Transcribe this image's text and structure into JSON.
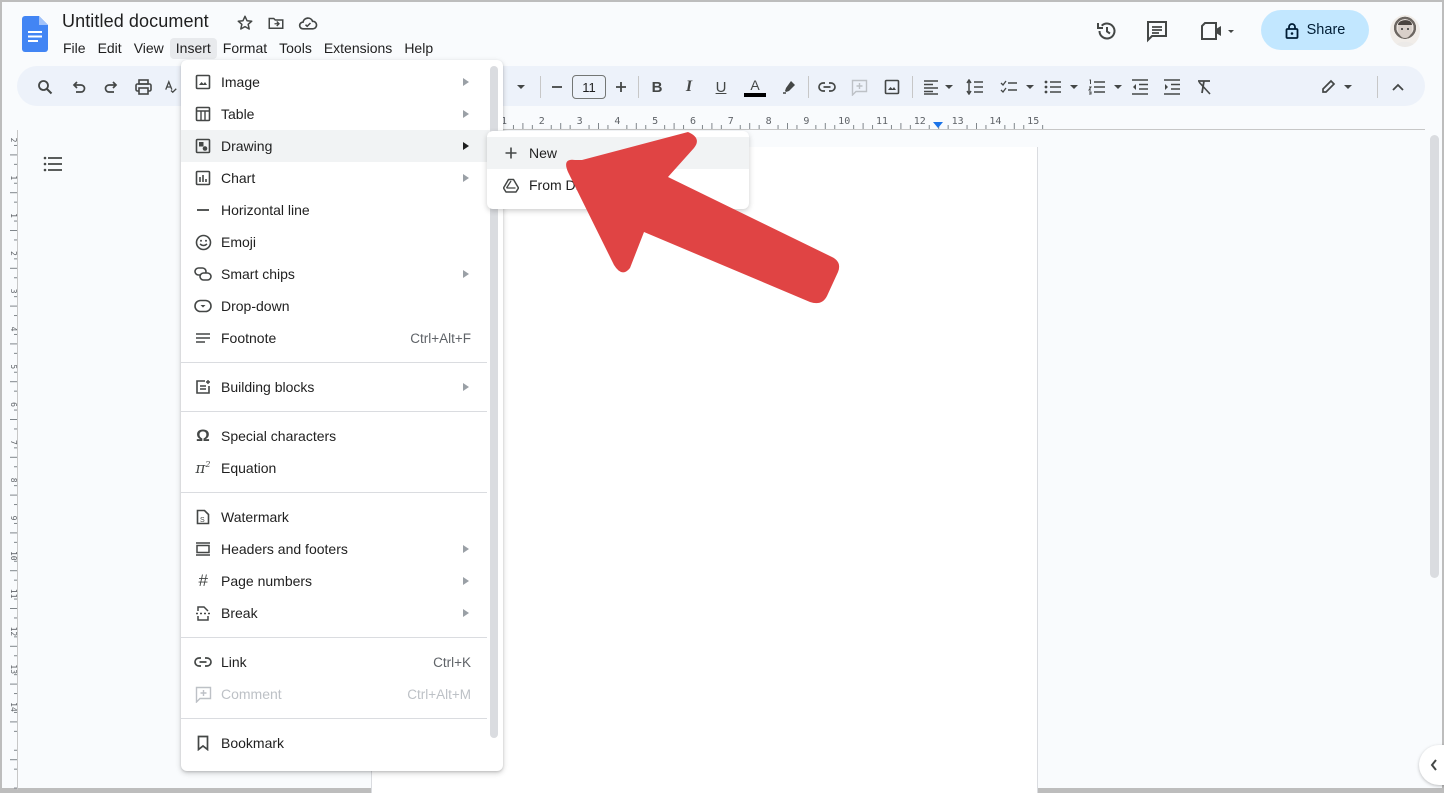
{
  "header": {
    "title": "Untitled document",
    "icons": [
      "docs-logo-icon",
      "star-icon",
      "move-to-folder-icon",
      "cloud-saved-icon"
    ],
    "right_icons": [
      "version-history-icon",
      "comments-icon",
      "meet-icon"
    ],
    "share_label": "Share"
  },
  "menubar": {
    "items": [
      "File",
      "Edit",
      "View",
      "Insert",
      "Format",
      "Tools",
      "Extensions",
      "Help"
    ],
    "active": "Insert"
  },
  "toolbar": {
    "font_size": "11",
    "icons": [
      "search-icon",
      "undo-icon",
      "redo-icon",
      "print-icon",
      "spellcheck-icon",
      "decrease-font-icon",
      "increase-font-icon",
      "bold-icon",
      "italic-icon",
      "underline-icon",
      "text-color-icon",
      "highlight-icon",
      "link-icon",
      "add-comment-icon",
      "insert-image-icon",
      "align-icon",
      "line-spacing-icon",
      "checklist-icon",
      "bulleted-list-icon",
      "numbered-list-icon",
      "decrease-indent-icon",
      "increase-indent-icon",
      "clear-formatting-icon",
      "editing-mode-icon",
      "collapse-toolbar-icon"
    ],
    "text_color": "#000000"
  },
  "ruler": {
    "labels": [
      "1",
      "2",
      "3",
      "4",
      "5",
      "6",
      "7",
      "8",
      "9",
      "10",
      "11",
      "12",
      "13",
      "14",
      "15"
    ],
    "vertical_labels": [
      "2",
      "1",
      "1",
      "2",
      "3",
      "4",
      "5",
      "6",
      "7",
      "8",
      "9",
      "10",
      "11",
      "12",
      "13",
      "14"
    ]
  },
  "insert_menu": {
    "groups": [
      [
        {
          "label": "Image",
          "icon": "image-icon",
          "submenu": true
        },
        {
          "label": "Table",
          "icon": "table-icon",
          "submenu": true
        },
        {
          "label": "Drawing",
          "icon": "drawing-icon",
          "submenu": true,
          "highlighted": true
        },
        {
          "label": "Chart",
          "icon": "chart-icon",
          "submenu": true
        },
        {
          "label": "Horizontal line",
          "icon": "horizontal-line-icon"
        },
        {
          "label": "Emoji",
          "icon": "emoji-icon"
        },
        {
          "label": "Smart chips",
          "icon": "smart-chips-icon",
          "submenu": true
        },
        {
          "label": "Drop-down",
          "icon": "dropdown-icon"
        },
        {
          "label": "Footnote",
          "icon": "footnote-icon",
          "shortcut": "Ctrl+Alt+F"
        }
      ],
      [
        {
          "label": "Building blocks",
          "icon": "building-blocks-icon",
          "submenu": true
        }
      ],
      [
        {
          "label": "Special characters",
          "icon": "omega-icon"
        },
        {
          "label": "Equation",
          "icon": "pi-icon"
        }
      ],
      [
        {
          "label": "Watermark",
          "icon": "watermark-icon"
        },
        {
          "label": "Headers and footers",
          "icon": "headers-footers-icon",
          "submenu": true
        },
        {
          "label": "Page numbers",
          "icon": "hash-icon",
          "submenu": true
        },
        {
          "label": "Break",
          "icon": "break-icon",
          "submenu": true
        }
      ],
      [
        {
          "label": "Link",
          "icon": "link-icon",
          "shortcut": "Ctrl+K"
        },
        {
          "label": "Comment",
          "icon": "comment-icon",
          "shortcut": "Ctrl+Alt+M",
          "disabled": true
        }
      ],
      [
        {
          "label": "Bookmark",
          "icon": "bookmark-icon"
        }
      ]
    ]
  },
  "drawing_submenu": {
    "items": [
      {
        "label": "New",
        "icon": "plus-icon",
        "highlighted": true
      },
      {
        "label": "From Drive",
        "icon": "drive-icon"
      }
    ]
  },
  "annotation": {
    "type": "arrow",
    "color": "#e04444",
    "points_to": "New"
  }
}
